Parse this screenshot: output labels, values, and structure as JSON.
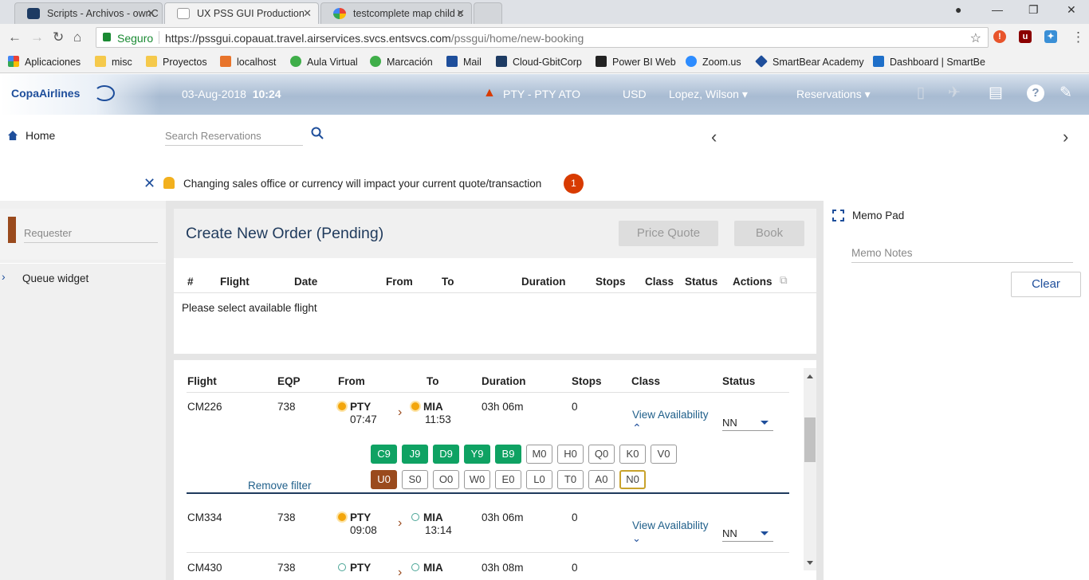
{
  "browser": {
    "tabs": [
      {
        "label": "Scripts - Archivos - ownC"
      },
      {
        "label": "UX PSS GUI Production"
      },
      {
        "label": "testcomplete map child c"
      }
    ],
    "secure_label": "Seguro",
    "url_host": "https://pssgui.copauat.travel.airservices.svcs.entsvcs.com",
    "url_path": "/pssgui/home/new-booking",
    "bookmarks": [
      "Aplicaciones",
      "misc",
      "Proyectos",
      "localhost",
      "Aula Virtual",
      "Marcación",
      "Mail",
      "Cloud-GbitCorp",
      "Power BI Web",
      "Zoom.us",
      "SmartBear Academy",
      "Dashboard | SmartBe"
    ]
  },
  "header": {
    "logo": "CopaAirlines",
    "date": "03-Aug-2018",
    "time": "10:24",
    "office": "PTY - PTY ATO",
    "currency": "USD",
    "user": "Lopez, Wilson",
    "menu": "Reservations"
  },
  "nav": {
    "home": "Home",
    "search_placeholder": "Search Reservations"
  },
  "notification": {
    "message": "Changing sales office or currency will impact your current quote/transaction",
    "count": "1"
  },
  "left": {
    "requester_placeholder": "Requester",
    "queue_label": "Queue widget"
  },
  "order": {
    "title": "Create New Order (Pending)",
    "price_quote": "Price Quote",
    "book": "Book",
    "columns": [
      "#",
      "Flight",
      "Date",
      "From",
      "To",
      "Duration",
      "Stops",
      "Class",
      "Status",
      "Actions"
    ],
    "empty_message": "Please select available flight"
  },
  "flights": {
    "columns": [
      "Flight",
      "EQP",
      "From",
      "To",
      "Duration",
      "Stops",
      "Class",
      "Status"
    ],
    "rows": [
      {
        "flight": "CM226",
        "eqp": "738",
        "from": "PTY",
        "dep": "07:47",
        "to": "MIA",
        "arr": "11:53",
        "duration": "03h 06m",
        "stops": "0",
        "availability": "View Availability",
        "status": "NN"
      },
      {
        "flight": "CM334",
        "eqp": "738",
        "from": "PTY",
        "dep": "09:08",
        "to": "MIA",
        "arr": "13:14",
        "duration": "03h 06m",
        "stops": "0",
        "availability": "View Availability",
        "status": "NN"
      },
      {
        "flight": "CM430",
        "eqp": "738",
        "from": "PTY",
        "dep": "",
        "to": "MIA",
        "arr": "",
        "duration": "03h 08m",
        "stops": "0",
        "availability": "",
        "status": ""
      }
    ],
    "classes_row1": [
      "C9",
      "J9",
      "D9",
      "Y9",
      "B9",
      "M0",
      "H0",
      "Q0",
      "K0",
      "V0"
    ],
    "classes_row2": [
      "U0",
      "S0",
      "O0",
      "W0",
      "E0",
      "L0",
      "T0",
      "A0",
      "N0"
    ],
    "remove_filter": "Remove filter"
  },
  "memo": {
    "title": "Memo Pad",
    "notes_placeholder": "Memo Notes",
    "clear": "Clear"
  }
}
